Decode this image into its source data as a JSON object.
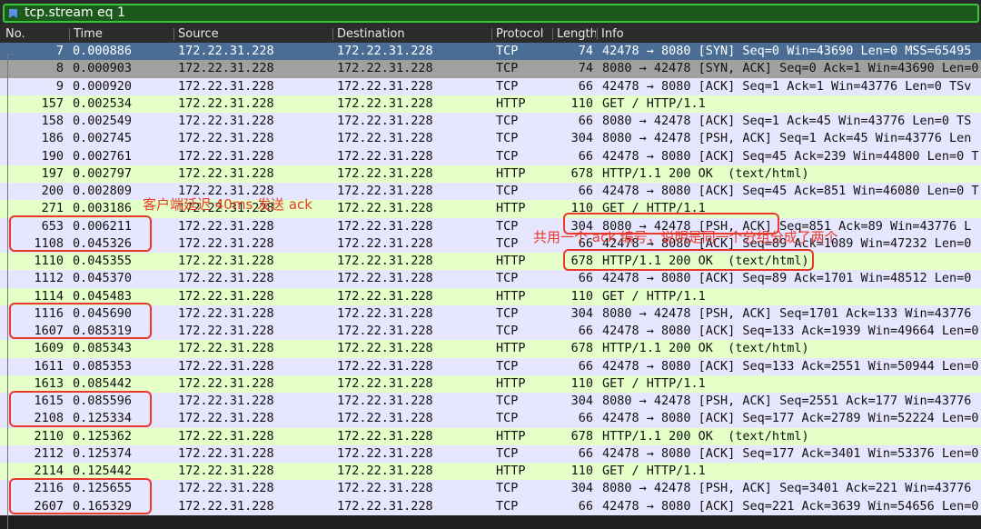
{
  "filter": {
    "text": "tcp.stream eq 1"
  },
  "columns": [
    "No.",
    "Time",
    "Source",
    "Destination",
    "Protocol",
    "Length",
    "Info"
  ],
  "colors": {
    "tcp_row": "#e7e6ff",
    "http_row": "#e4ffc7",
    "selected_row": "#4a6d96",
    "ack_row": "#a0a0a0"
  },
  "rows": [
    {
      "no": "7",
      "time": "0.000886",
      "src": "172.22.31.228",
      "dst": "172.22.31.228",
      "proto": "TCP",
      "len": "74",
      "info": "42478 → 8080 [SYN] Seq=0 Win=43690 Len=0 MSS=65495",
      "kind": "selected"
    },
    {
      "no": "8",
      "time": "0.000903",
      "src": "172.22.31.228",
      "dst": "172.22.31.228",
      "proto": "TCP",
      "len": "74",
      "info": "8080 → 42478 [SYN, ACK] Seq=0 Ack=1 Win=43690 Len=0",
      "kind": "ack"
    },
    {
      "no": "9",
      "time": "0.000920",
      "src": "172.22.31.228",
      "dst": "172.22.31.228",
      "proto": "TCP",
      "len": "66",
      "info": "42478 → 8080 [ACK] Seq=1 Ack=1 Win=43776 Len=0 TSv",
      "kind": "tcp"
    },
    {
      "no": "157",
      "time": "0.002534",
      "src": "172.22.31.228",
      "dst": "172.22.31.228",
      "proto": "HTTP",
      "len": "110",
      "info": "GET / HTTP/1.1",
      "kind": "http"
    },
    {
      "no": "158",
      "time": "0.002549",
      "src": "172.22.31.228",
      "dst": "172.22.31.228",
      "proto": "TCP",
      "len": "66",
      "info": "8080 → 42478 [ACK] Seq=1 Ack=45 Win=43776 Len=0 TS",
      "kind": "tcp"
    },
    {
      "no": "186",
      "time": "0.002745",
      "src": "172.22.31.228",
      "dst": "172.22.31.228",
      "proto": "TCP",
      "len": "304",
      "info": "8080 → 42478 [PSH, ACK] Seq=1 Ack=45 Win=43776 Len",
      "kind": "tcp"
    },
    {
      "no": "190",
      "time": "0.002761",
      "src": "172.22.31.228",
      "dst": "172.22.31.228",
      "proto": "TCP",
      "len": "66",
      "info": "42478 → 8080 [ACK] Seq=45 Ack=239 Win=44800 Len=0 T",
      "kind": "tcp"
    },
    {
      "no": "197",
      "time": "0.002797",
      "src": "172.22.31.228",
      "dst": "172.22.31.228",
      "proto": "HTTP",
      "len": "678",
      "info": "HTTP/1.1 200 OK  (text/html)",
      "kind": "http"
    },
    {
      "no": "200",
      "time": "0.002809",
      "src": "172.22.31.228",
      "dst": "172.22.31.228",
      "proto": "TCP",
      "len": "66",
      "info": "42478 → 8080 [ACK] Seq=45 Ack=851 Win=46080 Len=0 T",
      "kind": "tcp"
    },
    {
      "no": "271",
      "time": "0.003186",
      "src": "172.22.31.228",
      "dst": "172.22.31.228",
      "proto": "HTTP",
      "len": "110",
      "info": "GET / HTTP/1.1",
      "kind": "http"
    },
    {
      "no": "653",
      "time": "0.006211",
      "src": "172.22.31.228",
      "dst": "172.22.31.228",
      "proto": "TCP",
      "len": "304",
      "info": "8080 → 42478 [PSH, ACK] Seq=851 Ack=89 Win=43776 L",
      "kind": "tcp"
    },
    {
      "no": "1108",
      "time": "0.045326",
      "src": "172.22.31.228",
      "dst": "172.22.31.228",
      "proto": "TCP",
      "len": "66",
      "info": "42478 → 8080 [ACK] Seq=89 Ack=1089 Win=47232 Len=0",
      "kind": "tcp"
    },
    {
      "no": "1110",
      "time": "0.045355",
      "src": "172.22.31.228",
      "dst": "172.22.31.228",
      "proto": "HTTP",
      "len": "678",
      "info": "HTTP/1.1 200 OK  (text/html)",
      "kind": "http"
    },
    {
      "no": "1112",
      "time": "0.045370",
      "src": "172.22.31.228",
      "dst": "172.22.31.228",
      "proto": "TCP",
      "len": "66",
      "info": "42478 → 8080 [ACK] Seq=89 Ack=1701 Win=48512 Len=0",
      "kind": "tcp"
    },
    {
      "no": "1114",
      "time": "0.045483",
      "src": "172.22.31.228",
      "dst": "172.22.31.228",
      "proto": "HTTP",
      "len": "110",
      "info": "GET / HTTP/1.1",
      "kind": "http"
    },
    {
      "no": "1116",
      "time": "0.045690",
      "src": "172.22.31.228",
      "dst": "172.22.31.228",
      "proto": "TCP",
      "len": "304",
      "info": "8080 → 42478 [PSH, ACK] Seq=1701 Ack=133 Win=43776",
      "kind": "tcp"
    },
    {
      "no": "1607",
      "time": "0.085319",
      "src": "172.22.31.228",
      "dst": "172.22.31.228",
      "proto": "TCP",
      "len": "66",
      "info": "42478 → 8080 [ACK] Seq=133 Ack=1939 Win=49664 Len=0",
      "kind": "tcp"
    },
    {
      "no": "1609",
      "time": "0.085343",
      "src": "172.22.31.228",
      "dst": "172.22.31.228",
      "proto": "HTTP",
      "len": "678",
      "info": "HTTP/1.1 200 OK  (text/html)",
      "kind": "http"
    },
    {
      "no": "1611",
      "time": "0.085353",
      "src": "172.22.31.228",
      "dst": "172.22.31.228",
      "proto": "TCP",
      "len": "66",
      "info": "42478 → 8080 [ACK] Seq=133 Ack=2551 Win=50944 Len=0",
      "kind": "tcp"
    },
    {
      "no": "1613",
      "time": "0.085442",
      "src": "172.22.31.228",
      "dst": "172.22.31.228",
      "proto": "HTTP",
      "len": "110",
      "info": "GET / HTTP/1.1",
      "kind": "http"
    },
    {
      "no": "1615",
      "time": "0.085596",
      "src": "172.22.31.228",
      "dst": "172.22.31.228",
      "proto": "TCP",
      "len": "304",
      "info": "8080 → 42478 [PSH, ACK] Seq=2551 Ack=177 Win=43776",
      "kind": "tcp"
    },
    {
      "no": "2108",
      "time": "0.125334",
      "src": "172.22.31.228",
      "dst": "172.22.31.228",
      "proto": "TCP",
      "len": "66",
      "info": "42478 → 8080 [ACK] Seq=177 Ack=2789 Win=52224 Len=0",
      "kind": "tcp"
    },
    {
      "no": "2110",
      "time": "0.125362",
      "src": "172.22.31.228",
      "dst": "172.22.31.228",
      "proto": "HTTP",
      "len": "678",
      "info": "HTTP/1.1 200 OK  (text/html)",
      "kind": "http"
    },
    {
      "no": "2112",
      "time": "0.125374",
      "src": "172.22.31.228",
      "dst": "172.22.31.228",
      "proto": "TCP",
      "len": "66",
      "info": "42478 → 8080 [ACK] Seq=177 Ack=3401 Win=53376 Len=0",
      "kind": "tcp"
    },
    {
      "no": "2114",
      "time": "0.125442",
      "src": "172.22.31.228",
      "dst": "172.22.31.228",
      "proto": "HTTP",
      "len": "110",
      "info": "GET / HTTP/1.1",
      "kind": "http"
    },
    {
      "no": "2116",
      "time": "0.125655",
      "src": "172.22.31.228",
      "dst": "172.22.31.228",
      "proto": "TCP",
      "len": "304",
      "info": "8080 → 42478 [PSH, ACK] Seq=3401 Ack=221 Win=43776",
      "kind": "tcp"
    },
    {
      "no": "2607",
      "time": "0.165329",
      "src": "172.22.31.228",
      "dst": "172.22.31.228",
      "proto": "TCP",
      "len": "66",
      "info": "42478 → 8080 [ACK] Seq=221 Ack=3639 Win=54656 Len=0",
      "kind": "tcp"
    }
  ],
  "annotations": {
    "client_delay": "客户端延迟 40ms 发送 ack",
    "shared_ack": "共用一个 ack 编号，说明是同一个分组分成了两个"
  }
}
